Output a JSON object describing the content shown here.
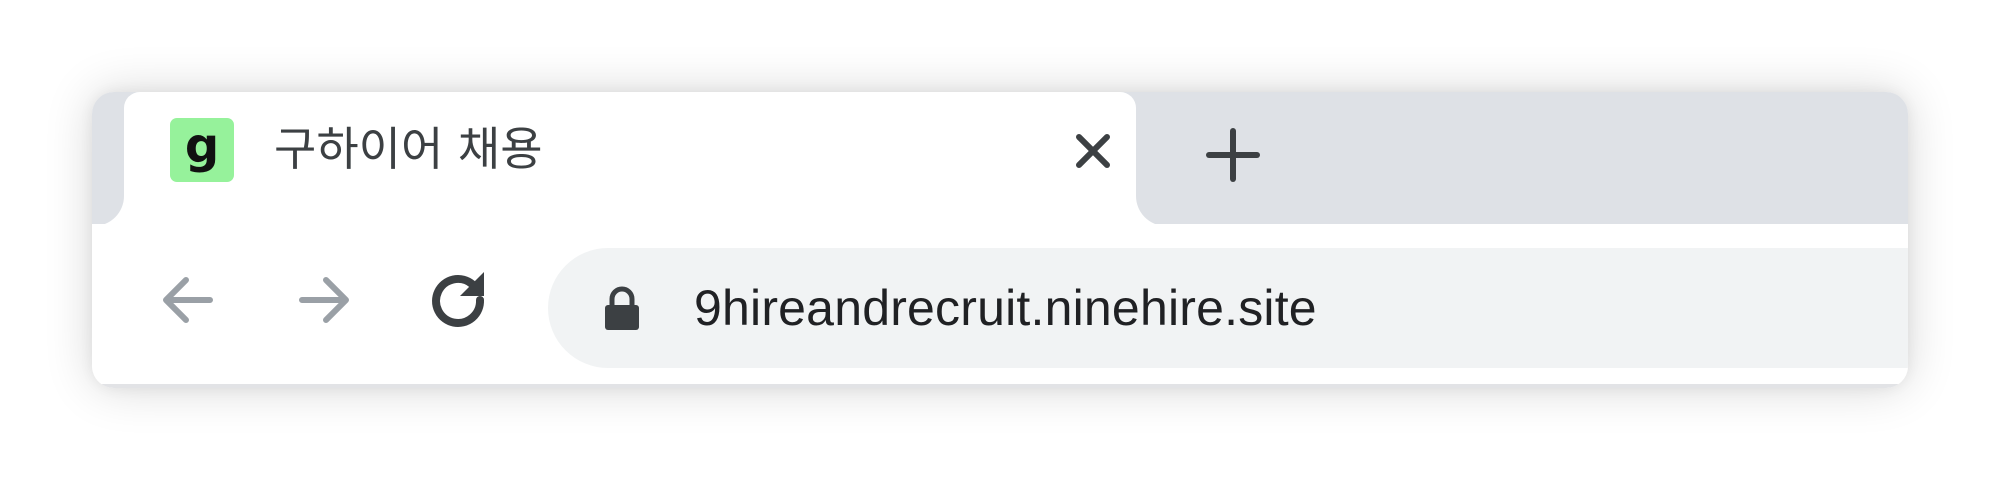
{
  "tab": {
    "favicon_letter": "g",
    "favicon_color": "#96f29b",
    "title": "구하이어 채용",
    "close_icon": "close-icon"
  },
  "newtab": {
    "icon": "plus-icon"
  },
  "toolbar": {
    "back_icon": "arrow-left-icon",
    "forward_icon": "arrow-right-icon",
    "reload_icon": "reload-icon"
  },
  "omnibox": {
    "lock_icon": "lock-icon",
    "url": "9hireandrecruit.ninehire.site"
  },
  "colors": {
    "tabstrip_bg": "#dee1e6",
    "omnibox_bg": "#f1f3f4",
    "icon_color": "#3c4043",
    "disabled_icon_color": "#9aa0a6"
  }
}
